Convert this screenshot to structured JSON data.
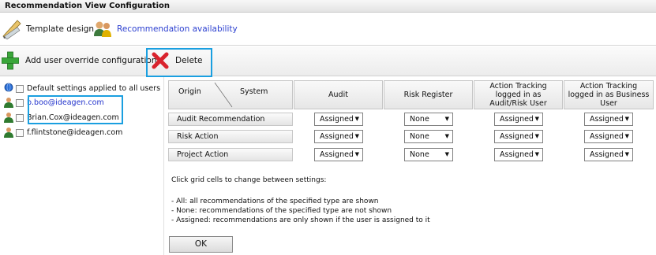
{
  "window": {
    "title": "Recommendation View Configuration"
  },
  "toolbar": {
    "template_design": "Template design",
    "recommendation_availability": "Recommendation availability",
    "add_override": "Add user override configuration",
    "delete": "Delete"
  },
  "tree": {
    "items": [
      {
        "label": "Default settings applied to all users",
        "icon": "globe-icon"
      },
      {
        "label": "b.boo@ideagen.com",
        "icon": "user-icon"
      },
      {
        "label": "Brian.Cox@ideagen.com",
        "icon": "user-icon"
      },
      {
        "label": "f.flintstone@ideagen.com",
        "icon": "user-icon"
      }
    ]
  },
  "grid": {
    "corner_origin": "Origin",
    "corner_system": "System",
    "columns": [
      "Audit",
      "Risk Register",
      "Action Tracking logged in as Audit/Risk User",
      "Action Tracking logged in as Business User"
    ],
    "rows": [
      {
        "label": "Audit Recommendation",
        "values": [
          "Assigned",
          "None",
          "Assigned",
          "Assigned"
        ]
      },
      {
        "label": "Risk Action",
        "values": [
          "Assigned",
          "None",
          "Assigned",
          "Assigned"
        ]
      },
      {
        "label": "Project Action",
        "values": [
          "Assigned",
          "None",
          "Assigned",
          "Assigned"
        ]
      }
    ]
  },
  "help": {
    "intro": "Click grid cells to change between settings:",
    "all": "- All: all recommendations of the specified type are shown",
    "none": "- None: recommendations of the specified type are not shown",
    "assigned": "- Assigned: recommendations are only shown if the user is assigned to it"
  },
  "ok_label": "OK",
  "colors": {
    "highlight": "#1a9fe0",
    "link": "#2b3fd0",
    "delete_red": "#d9232d",
    "add_green": "#3aa63a"
  }
}
